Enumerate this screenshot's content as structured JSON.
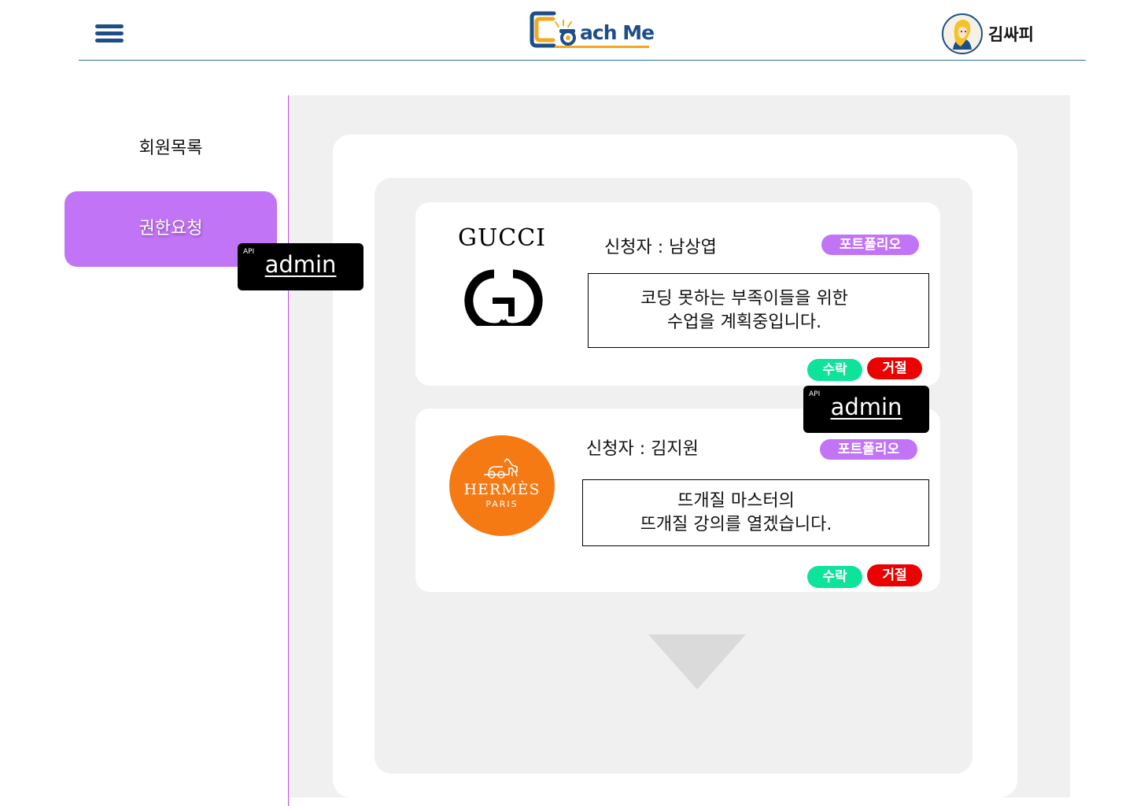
{
  "header": {
    "logo_text": "ach Me",
    "user_name": "김싸피"
  },
  "sidebar": {
    "items": [
      {
        "label": "회원목록",
        "active": false
      },
      {
        "label": "권한요청",
        "active": true
      }
    ]
  },
  "api_tags": [
    {
      "small": "API",
      "label": "admin"
    },
    {
      "small": "API",
      "label": "admin"
    }
  ],
  "requests": [
    {
      "logo_text": "GUCCI",
      "applicant": "신청자 : 남상엽",
      "portfolio_label": "포트폴리오",
      "description_line1": "코딩 못하는 부족이들을 위한",
      "description_line2": "수업을 계획중입니다.",
      "accept_label": "수락",
      "reject_label": "거절"
    },
    {
      "logo_name": "HERMÈS",
      "logo_city": "PARIS",
      "applicant": "신청자 : 김지원",
      "portfolio_label": "포트폴리오",
      "description_line1": "뜨개질 마스터의",
      "description_line2": "뜨개질 강의를 열겠습니다.",
      "accept_label": "수락",
      "reject_label": "거절"
    }
  ],
  "colors": {
    "brand_navy": "#1d4e89",
    "accent_purple": "#c274f6",
    "accept_green": "#0ee39a",
    "reject_red": "#ee0000",
    "hermes_orange": "#f57a13",
    "logo_orange": "#f3a81d"
  }
}
